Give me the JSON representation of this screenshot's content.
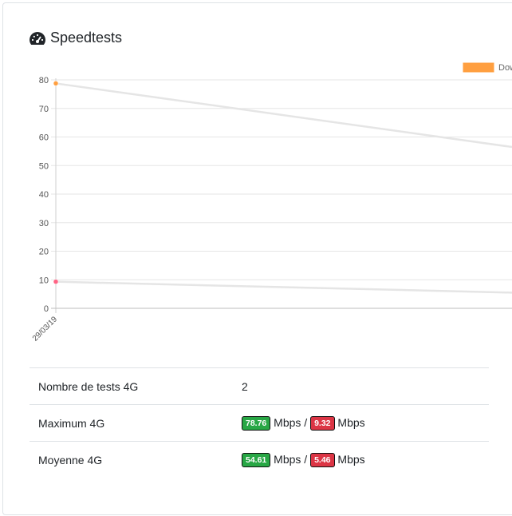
{
  "card": {
    "title": "Speedtests",
    "title_icon": "tachometer-icon"
  },
  "chart_data": {
    "type": "line",
    "x": [
      "29/03/19"
    ],
    "yticks": [
      0,
      10,
      20,
      30,
      40,
      50,
      60,
      70,
      80
    ],
    "ylim": [
      0,
      80
    ],
    "grid": true,
    "legend_placement": "top-right",
    "legend_label": "Dow",
    "series": [
      {
        "values": [
          78.76
        ],
        "trend_to": 56.5,
        "line_color": "#e5e5e5",
        "point_color": "#ff9f40"
      },
      {
        "values": [
          9.32
        ],
        "trend_to": 5.5,
        "line_color": "#e5e5e5",
        "point_color": "#ff6384"
      }
    ],
    "legend_color": "#ff9f40"
  },
  "stats": {
    "rows": [
      {
        "label": "Nombre de tests 4G",
        "value": "2"
      },
      {
        "label": "Maximum 4G",
        "down": "78.76",
        "up": "9.32",
        "unit": "Mbps",
        "sep": "/"
      },
      {
        "label": "Moyenne 4G",
        "down": "54.61",
        "up": "5.46",
        "unit": "Mbps",
        "sep": "/"
      }
    ]
  },
  "colors": {
    "green": "#28a745",
    "red": "#dc3545",
    "border": "#dee2e6"
  }
}
